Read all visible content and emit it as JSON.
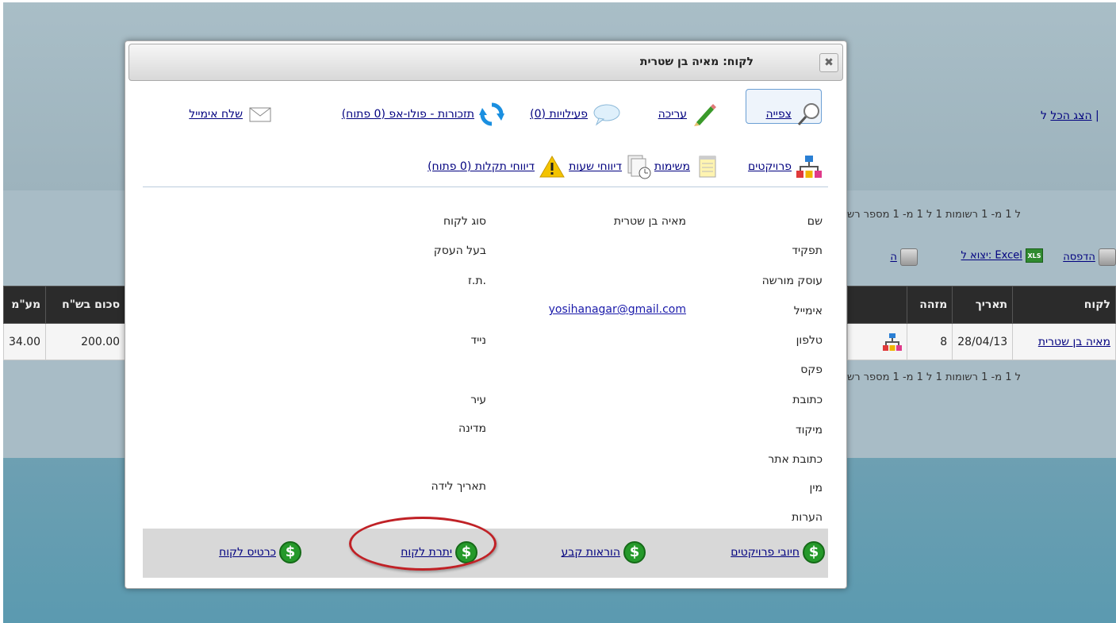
{
  "background": {
    "show_all_link": "הצג הכל",
    "show_all_prefix": "ל |",
    "pager_top": "ל 1 מ- 1   רשומות 1 ל 1 מ- 1   מספר רש",
    "pager_bottom": "ל 1 מ- 1   רשומות 1 ל 1 מ- 1   מספר רש",
    "toolbar": {
      "print_label": "הדפסה",
      "export_label": "יצוא ל: Excel",
      "xls_badge": "XLS",
      "partial_link": "ה"
    },
    "table_right": {
      "headers": [
        "מזהה",
        "תאריך",
        "לקוח"
      ],
      "row": {
        "id": "8",
        "date": "28/04/13",
        "customer": "מאיה בן שטרית"
      }
    },
    "table_left": {
      "headers": [
        "סכום בש\"ח",
        "מע\"מ"
      ],
      "row": {
        "amount": "200.00",
        "vat": "34.00"
      }
    }
  },
  "modal": {
    "title": "לקוח: מאיה בן שטרית",
    "close_glyph": "✖",
    "toolbar_row1": {
      "view": "צפייה",
      "edit": "עריכה",
      "activities": "פעילויות (0)",
      "reminders": "תזכורות - פולו-אפ (0 פתוח)",
      "send_email": "שלח אימייל"
    },
    "toolbar_row2": {
      "projects": "פרויקטים",
      "tasks": "משימות",
      "time_reports": "דיווחי שעות",
      "fault_reports": "דיווחי תקלות (0 פתוח)"
    },
    "fields": {
      "name_label": "שם",
      "name_value": "מאיה בן שטרית",
      "customer_type_label": "סוג לקוח",
      "role_label": "תפקיד",
      "business_owner_label": "בעל העסק",
      "licensed_business_label": "עוסק מורשה",
      "id_label": "ת.ז.",
      "email_label": "אימייל",
      "email_value": "yosihanagar@gmail.com",
      "phone_label": "טלפון",
      "mobile_label": "נייד",
      "fax_label": "פקס",
      "address_label": "כתובת",
      "city_label": "עיר",
      "zip_label": "מיקוד",
      "country_label": "מדינה",
      "website_label": "כתובת אתר",
      "gender_label": "מין",
      "birthdate_label": "תאריך לידה",
      "notes_label": "הערות"
    },
    "footer": {
      "project_charges": "חיובי פרויקטים",
      "standing_orders": "הוראות קבע",
      "customer_balance": "יתרת לקוח",
      "customer_card": "כרטיס לקוח",
      "dollar_glyph": "$"
    },
    "highlight_color": "#c02126"
  }
}
